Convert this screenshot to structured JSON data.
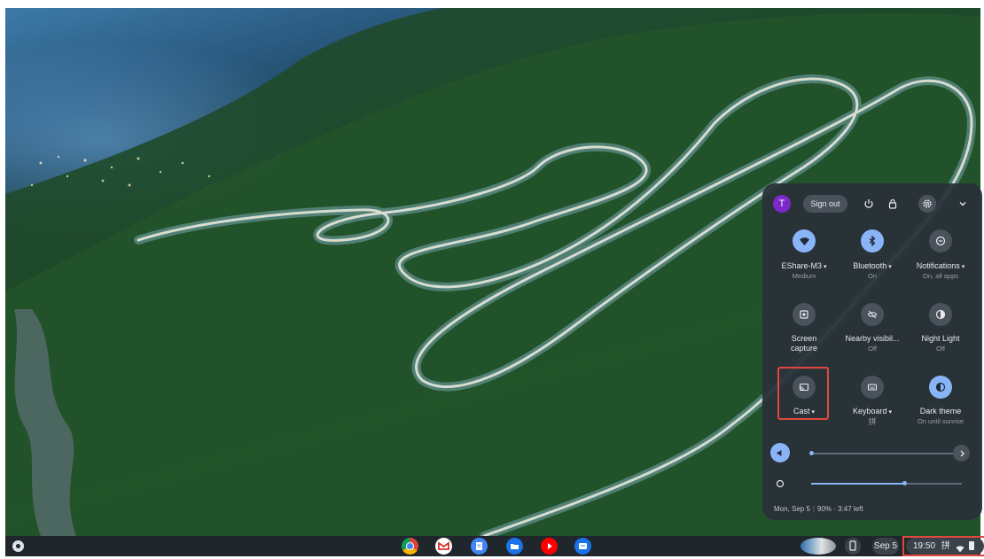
{
  "quick_settings": {
    "avatar_initial": "T",
    "sign_out_label": "Sign out",
    "top_icons": [
      "power-icon",
      "lock-icon",
      "gear-icon",
      "chevron-down-icon"
    ],
    "tiles": [
      {
        "label": "EShare-M3",
        "sub": "Medium",
        "icon": "wifi-icon",
        "active": true,
        "has_menu": true
      },
      {
        "label": "Bluetooth",
        "sub": "On",
        "icon": "bluetooth-icon",
        "active": true,
        "has_menu": true
      },
      {
        "label": "Notifications",
        "sub": "On, all apps",
        "icon": "do-not-disturb-icon",
        "active": false,
        "has_menu": true
      },
      {
        "label": "Screen\ncapture",
        "sub": "",
        "icon": "screen-capture-icon",
        "active": false,
        "has_menu": false
      },
      {
        "label": "Nearby visibil...",
        "sub": "Off",
        "icon": "nearby-share-off-icon",
        "active": false,
        "has_menu": false
      },
      {
        "label": "Night Light",
        "sub": "Off",
        "icon": "night-light-icon",
        "active": false,
        "has_menu": false
      },
      {
        "label": "Cast",
        "sub": "",
        "icon": "cast-icon",
        "active": false,
        "has_menu": true
      },
      {
        "label": "Keyboard",
        "sub": "拼",
        "icon": "keyboard-icon",
        "active": false,
        "has_menu": true
      },
      {
        "label": "Dark theme",
        "sub": "On until sunrise",
        "icon": "dark-theme-icon",
        "active": true,
        "has_menu": false
      }
    ],
    "volume_level": 0.0,
    "brightness_level": 0.62,
    "footer": {
      "date": "Mon, Sep 5",
      "battery": "90% · 3:47 left"
    }
  },
  "shelf": {
    "apps": [
      "chrome-icon",
      "gmail-icon",
      "docs-icon",
      "files-icon",
      "youtube-icon",
      "messages-icon"
    ],
    "date": "Sep 5",
    "time": "19:50",
    "ime": "拼"
  },
  "colors": {
    "accent": "#8ab4f8",
    "highlight_border": "#e0483f",
    "panel_bg": "#283038"
  }
}
